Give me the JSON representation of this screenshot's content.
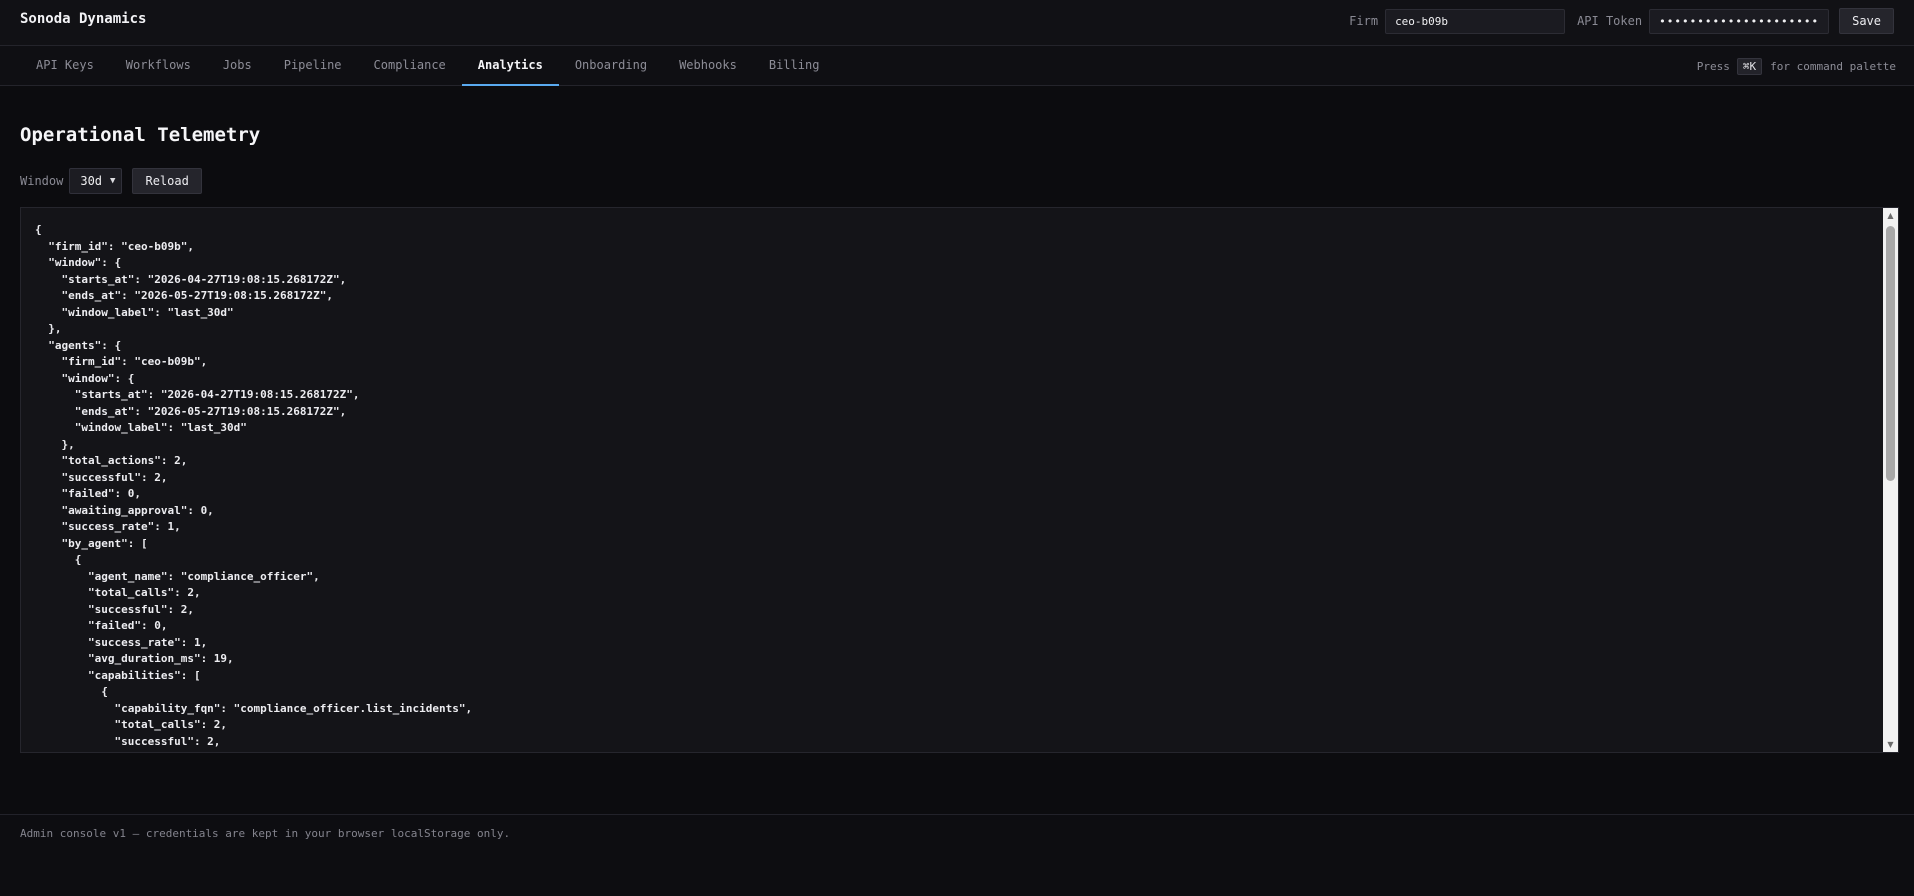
{
  "app": {
    "title": "Sonoda Dynamics"
  },
  "header": {
    "firm_label": "Firm",
    "firm_value": "ceo-b09b",
    "token_label": "API Token",
    "token_value": "••••••••••••••••••••••••••",
    "save_label": "Save"
  },
  "tabs": [
    {
      "label": "API Keys",
      "active": false
    },
    {
      "label": "Workflows",
      "active": false
    },
    {
      "label": "Jobs",
      "active": false
    },
    {
      "label": "Pipeline",
      "active": false
    },
    {
      "label": "Compliance",
      "active": false
    },
    {
      "label": "Analytics",
      "active": true
    },
    {
      "label": "Onboarding",
      "active": false
    },
    {
      "label": "Webhooks",
      "active": false
    },
    {
      "label": "Billing",
      "active": false
    }
  ],
  "command_hint": {
    "prefix": "Press",
    "key": "⌘K",
    "suffix": "for command palette"
  },
  "page": {
    "title": "Operational Telemetry"
  },
  "controls": {
    "window_label": "Window",
    "window_value": "30d",
    "reload_label": "Reload"
  },
  "json_output": "{\n  \"firm_id\": \"ceo-b09b\",\n  \"window\": {\n    \"starts_at\": \"2026-04-27T19:08:15.268172Z\",\n    \"ends_at\": \"2026-05-27T19:08:15.268172Z\",\n    \"window_label\": \"last_30d\"\n  },\n  \"agents\": {\n    \"firm_id\": \"ceo-b09b\",\n    \"window\": {\n      \"starts_at\": \"2026-04-27T19:08:15.268172Z\",\n      \"ends_at\": \"2026-05-27T19:08:15.268172Z\",\n      \"window_label\": \"last_30d\"\n    },\n    \"total_actions\": 2,\n    \"successful\": 2,\n    \"failed\": 0,\n    \"awaiting_approval\": 0,\n    \"success_rate\": 1,\n    \"by_agent\": [\n      {\n        \"agent_name\": \"compliance_officer\",\n        \"total_calls\": 2,\n        \"successful\": 2,\n        \"failed\": 0,\n        \"success_rate\": 1,\n        \"avg_duration_ms\": 19,\n        \"capabilities\": [\n          {\n            \"capability_fqn\": \"compliance_officer.list_incidents\",\n            \"total_calls\": 2,\n            \"successful\": 2,",
  "footer": {
    "text": "Admin console v1 — credentials are kept in your browser localStorage only."
  },
  "icons": {
    "select_chevron": "chevron-down-icon",
    "scroll_up": "scroll-up-arrow-icon",
    "scroll_down": "scroll-down-arrow-icon"
  },
  "colors": {
    "accent": "#5aaaf0",
    "background": "#0c0c0f",
    "panel": "#141418"
  }
}
